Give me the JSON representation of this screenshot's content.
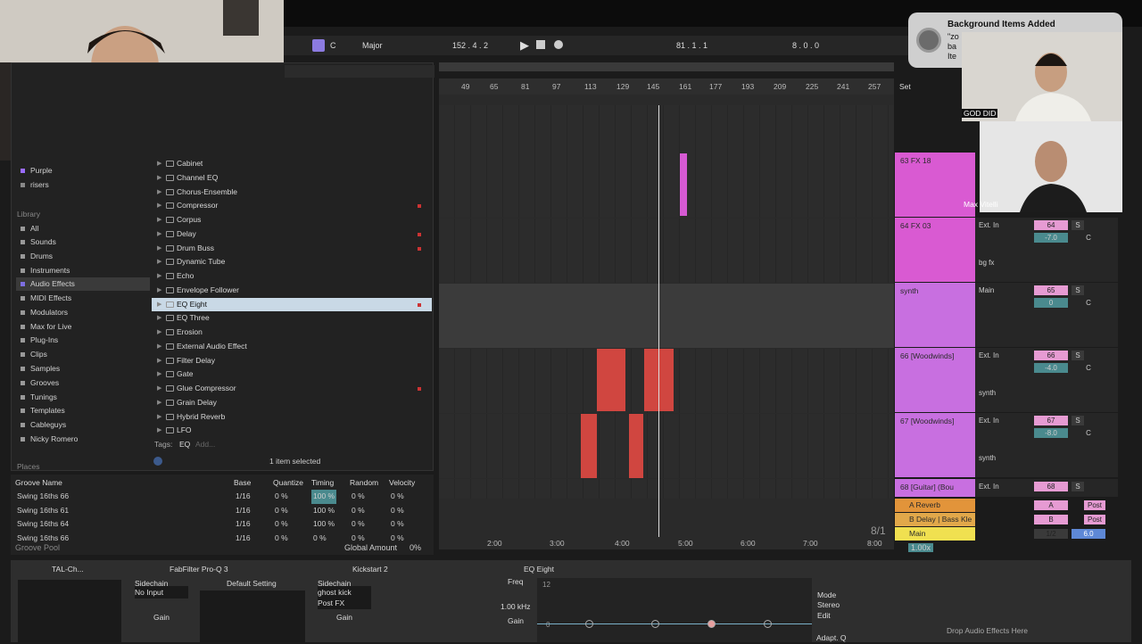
{
  "transport": {
    "key": "C",
    "scale": "Major",
    "tempo_position": "152 . 4 . 2",
    "loop_start": "81 . 1 . 1",
    "loop_length": "8 . 0 . 0"
  },
  "browser": {
    "collections": [
      "Purple",
      "risers"
    ],
    "library_heading": "Library",
    "library": [
      "All",
      "Sounds",
      "Drums",
      "Instruments",
      "Audio Effects",
      "MIDI Effects",
      "Modulators",
      "Max for Live",
      "Plug-Ins",
      "Clips",
      "Samples",
      "Grooves",
      "Tunings",
      "Templates",
      "Cableguys",
      "Nicky Romero"
    ],
    "places_heading": "Places",
    "devices": [
      "Cabinet",
      "Channel EQ",
      "Chorus-Ensemble",
      "Compressor",
      "Corpus",
      "Delay",
      "Drum Buss",
      "Dynamic Tube",
      "Echo",
      "Envelope Follower",
      "EQ Eight",
      "EQ Three",
      "Erosion",
      "External Audio Effect",
      "Filter Delay",
      "Gate",
      "Glue Compressor",
      "Grain Delay",
      "Hybrid Reverb",
      "LFO"
    ],
    "tags_label": "Tags:",
    "tag": "EQ",
    "tag_add": "Add...",
    "status": "1 item selected"
  },
  "ruler": {
    "bars": [
      "49",
      "65",
      "81",
      "97",
      "113",
      "129",
      "145",
      "161",
      "177",
      "193",
      "209",
      "225",
      "241",
      "257"
    ],
    "set_label": "Set",
    "times": [
      "2:00",
      "3:00",
      "4:00",
      "5:00",
      "6:00",
      "7:00",
      "8:00"
    ]
  },
  "tracks": [
    {
      "name": "63 FX 18",
      "input": "",
      "num": "",
      "color": "#d95ad2"
    },
    {
      "name": "64 FX 03",
      "input": "Ext. In",
      "num": "64",
      "vol": "-7.0",
      "route": "bg fx",
      "color": "#d95ad2"
    },
    {
      "name": "synth",
      "input": "Main",
      "num": "65",
      "vol": "0",
      "route": "",
      "color": "#c86fe0"
    },
    {
      "name": "66 [Woodwinds]",
      "input": "Ext. In",
      "num": "66",
      "vol": "-4.0",
      "route": "synth",
      "color": "#c86fe0"
    },
    {
      "name": "67 [Woodwinds]",
      "input": "Ext. In",
      "num": "67",
      "vol": "-8.0",
      "route": "synth",
      "color": "#c86fe0"
    },
    {
      "name": "68 [Guitar] (Bou",
      "input": "Ext. In",
      "num": "68",
      "color": "#c86fe0"
    }
  ],
  "returns": [
    {
      "name": "A Reverb",
      "letter": "A",
      "post": "Post"
    },
    {
      "name": "B Delay | Bass Kle",
      "letter": "B",
      "post": "Post"
    },
    {
      "name": "Main",
      "letter": "1/2",
      "vol": "0",
      "pan": "6.0"
    }
  ],
  "mixer_labels": {
    "in": "In",
    "auto": "Auto",
    "off": "Off",
    "minf": "-∞",
    "s": "S",
    "c": "C",
    "ratio": "8/1",
    "zoom": "1.00x",
    "h": "H",
    "w": "W"
  },
  "groove": {
    "headers": [
      "Groove Name",
      "Base",
      "Quantize",
      "Timing",
      "Random",
      "Velocity"
    ],
    "rows": [
      [
        "Swing 16ths 66",
        "1/16",
        "0 %",
        "100 %",
        "0 %",
        "0 %"
      ],
      [
        "Swing 16ths 61",
        "1/16",
        "0 %",
        "100 %",
        "0 %",
        "0 %"
      ],
      [
        "Swing 16ths 64",
        "1/16",
        "0 %",
        "100 %",
        "0 %",
        "0 %"
      ],
      [
        "Swing 16ths 66",
        "1/16",
        "0 %",
        "0 %",
        "0 %",
        "0 %"
      ]
    ],
    "pool_label": "Groove Pool",
    "global_amount_label": "Global Amount",
    "global_amount": "0%"
  },
  "devices": {
    "d1": {
      "title": "TAL-Ch..."
    },
    "d2": {
      "title": "FabFilter Pro-Q 3",
      "sidechain": "Sidechain",
      "input": "No Input",
      "gain": "Gain",
      "preset": "Default Setting"
    },
    "d3": {
      "title": "Kickstart 2",
      "sidechain": "Sidechain",
      "input": "ghost kick",
      "post": "Post FX",
      "gain": "Gain"
    },
    "eq": {
      "title": "EQ Eight",
      "freq_label": "Freq",
      "freq": "1.00 kHz",
      "gain": "Gain",
      "db_top": "12",
      "db_mid": "0",
      "mode": "Mode",
      "stereo": "Stereo",
      "edit": "Edit",
      "adapt": "Adapt. Q"
    },
    "drop": "Drop Audio Effects Here"
  },
  "notification": {
    "title": "Background Items Added",
    "line1": "\"zo",
    "line2": "ba",
    "line3": "Ite"
  },
  "overlay": {
    "song_tag": "GOD DID",
    "guest_name": "Max Vitelli"
  }
}
